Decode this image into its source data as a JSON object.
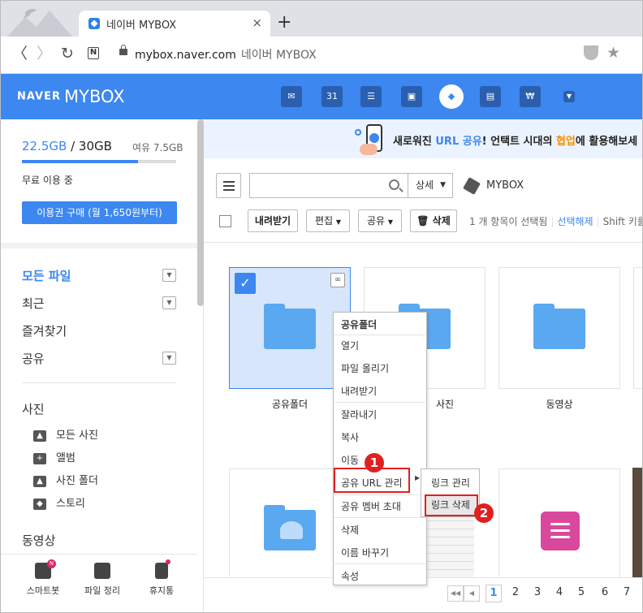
{
  "browser": {
    "tab_title": "네이버 MYBOX",
    "tab_close": "×",
    "new_tab": "+",
    "url": "mybox.naver.com",
    "page_title": "네이버 MYBOX",
    "back": "〈",
    "forward": "〉",
    "reload": "↻",
    "n_icon": "N",
    "star": "★"
  },
  "header": {
    "logo_naver": "NAVER",
    "logo_mybox": "MYBOX",
    "icons": [
      "mail-icon",
      "calendar-icon",
      "memo-icon",
      "contacts-icon",
      "mybox-icon",
      "office-icon",
      "pay-icon",
      "more-icon"
    ],
    "calendar_num": "31",
    "pay_sym": "₩"
  },
  "sidebar": {
    "used": "22.5GB",
    "total": " / 30GB",
    "free_label": "여유 7.5GB",
    "usage_fraction": 0.75,
    "free_use": "무료 이용 중",
    "buy_button": "이용권 구매 (월 1,650원부터)",
    "nav": [
      {
        "label": "모든 파일",
        "dropdown": true
      },
      {
        "label": "최근",
        "dropdown": true
      },
      {
        "label": "즐겨찾기",
        "dropdown": false
      },
      {
        "label": "공유",
        "dropdown": true
      }
    ],
    "photo_heading": "사진",
    "photo_items": [
      {
        "label": "모든 사진",
        "icon": "image-icon"
      },
      {
        "label": "앨범",
        "icon": "album-icon"
      },
      {
        "label": "사진 폴더",
        "icon": "photo-folder-icon"
      },
      {
        "label": "스토리",
        "icon": "story-icon"
      }
    ],
    "video_heading": "동영상",
    "bottom": [
      {
        "label": "스마트봇",
        "icon": "robot-icon",
        "badge": "N"
      },
      {
        "label": "파일 정리",
        "icon": "file-organize-icon"
      },
      {
        "label": "휴지통",
        "icon": "trash-icon"
      }
    ]
  },
  "banner": {
    "text_pre": "새로워진 ",
    "text_blue": "URL 공유",
    "text_mid": "! 언택트 시대의 ",
    "text_orange": "협업",
    "text_post": "에 활용해보세"
  },
  "toolbar": {
    "search_placeholder": "",
    "detail": "상세",
    "breadcrumb": "MYBOX",
    "download": "내려받기",
    "edit": "편집",
    "share": "공유",
    "delete": "삭제",
    "selected_status": "1 개 항목이 선택됨",
    "deselect": "선택해제",
    "shift_hint": "Shift 키를"
  },
  "files": [
    {
      "label": "공유폴더",
      "selected": true
    },
    {
      "label": "사진",
      "selected": false
    },
    {
      "label": "동영상",
      "selected": false
    }
  ],
  "context_menu": {
    "header": "공유폴더",
    "items": [
      "열기",
      "파일 올리기",
      "내려받기",
      "잘라내기",
      "복사",
      "이동",
      "공유 URL 관리",
      "공유 멤버 초대",
      "삭제",
      "이름 바꾸기",
      "속성"
    ],
    "submenu": [
      "링크 관리",
      "링크 삭제"
    ]
  },
  "annotations": {
    "step1": "1",
    "step2": "2"
  },
  "pagination": {
    "pages": [
      "1",
      "2",
      "3",
      "4",
      "5",
      "6",
      "7"
    ],
    "current": "1"
  }
}
